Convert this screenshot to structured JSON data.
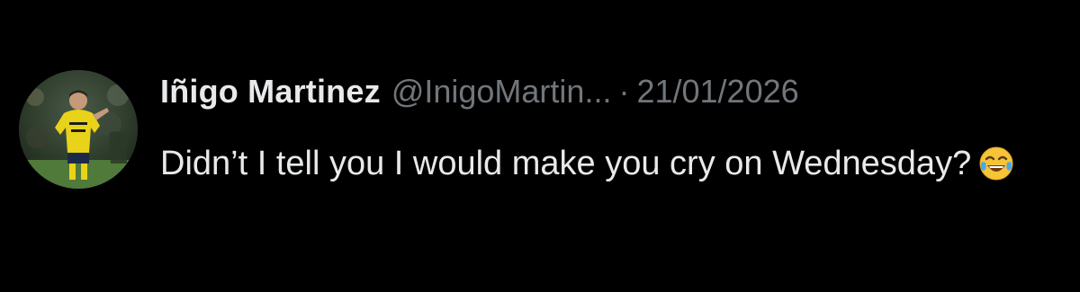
{
  "tweet": {
    "author_name": "Iñigo Martinez",
    "author_handle": "@InigoMartin...",
    "separator": "·",
    "date": "21/01/2026",
    "text": "Didn’t I tell you I would make you cry on Wednesday?",
    "emoji": "face-with-tears-of-joy-icon",
    "avatar_icon": "avatar"
  },
  "colors": {
    "background": "#000000",
    "primary_text": "#e7e9ea",
    "secondary_text": "#71767b",
    "jersey_yellow": "#e8d21a"
  }
}
